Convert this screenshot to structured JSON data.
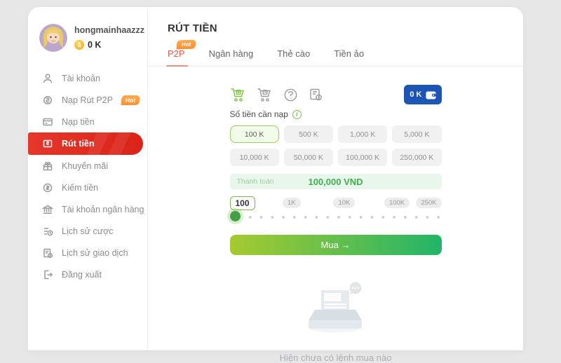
{
  "colors": {
    "accent_red": "#d92318",
    "tab_red": "#e2574a",
    "hot_orange": "#ff8f35",
    "accent_green": "#43a047",
    "light_green_bg": "#e9f6ec",
    "accent_blue": "#1d55b4",
    "page_bg": "#e6e6e6"
  },
  "profile": {
    "username": "hongmainhaazzz",
    "balance": "0 K",
    "coin_icon": "coin-icon"
  },
  "sidebar": {
    "items": [
      {
        "label": "Tài khoản",
        "icon": "user-icon"
      },
      {
        "label": "Nạp Rút P2P",
        "icon": "p2p-icon",
        "badge": "Hot"
      },
      {
        "label": "Nạp tiền",
        "icon": "deposit-icon"
      },
      {
        "label": "Rút tiền",
        "icon": "withdraw-icon",
        "active": true
      },
      {
        "label": "Khuyến mãi",
        "icon": "promotion-icon"
      },
      {
        "label": "Kiếm tiền",
        "icon": "earn-money-icon"
      },
      {
        "label": "Tài khoản ngân hàng",
        "icon": "bank-account-icon"
      },
      {
        "label": "Lịch sử cược",
        "icon": "bet-history-icon"
      },
      {
        "label": "Lịch sử giao dịch",
        "icon": "transaction-history-icon"
      },
      {
        "label": "Đăng xuất",
        "icon": "logout-icon"
      }
    ]
  },
  "header": {
    "title": "RÚT TIỀN",
    "tabs": [
      {
        "label": "P2P",
        "active": true,
        "badge": "Hot"
      },
      {
        "label": "Ngân hàng"
      },
      {
        "label": "Thẻ cào"
      },
      {
        "label": "Tiền ảo"
      }
    ]
  },
  "form": {
    "action_icons": [
      "cart-plus-icon",
      "cart-minus-icon",
      "help-icon",
      "order-history-icon"
    ],
    "wallet_balance": "0 K",
    "amount_label": "Số tiền cần nạp",
    "amounts": [
      "100 K",
      "500 K",
      "1,000 K",
      "5,000 K",
      "10,000 K",
      "50,000 K",
      "100,000 K",
      "250,000 K"
    ],
    "selected_amount": "100 K",
    "payment_label": "Thanh toán",
    "payment_value": "100,000 VND",
    "slider": {
      "value": "100",
      "marks": [
        "1K",
        "10K",
        "100K",
        "250K"
      ]
    },
    "buy_button": "Mua →"
  },
  "empty_state": {
    "message": "Hiện chưa có lệnh mua nào"
  }
}
